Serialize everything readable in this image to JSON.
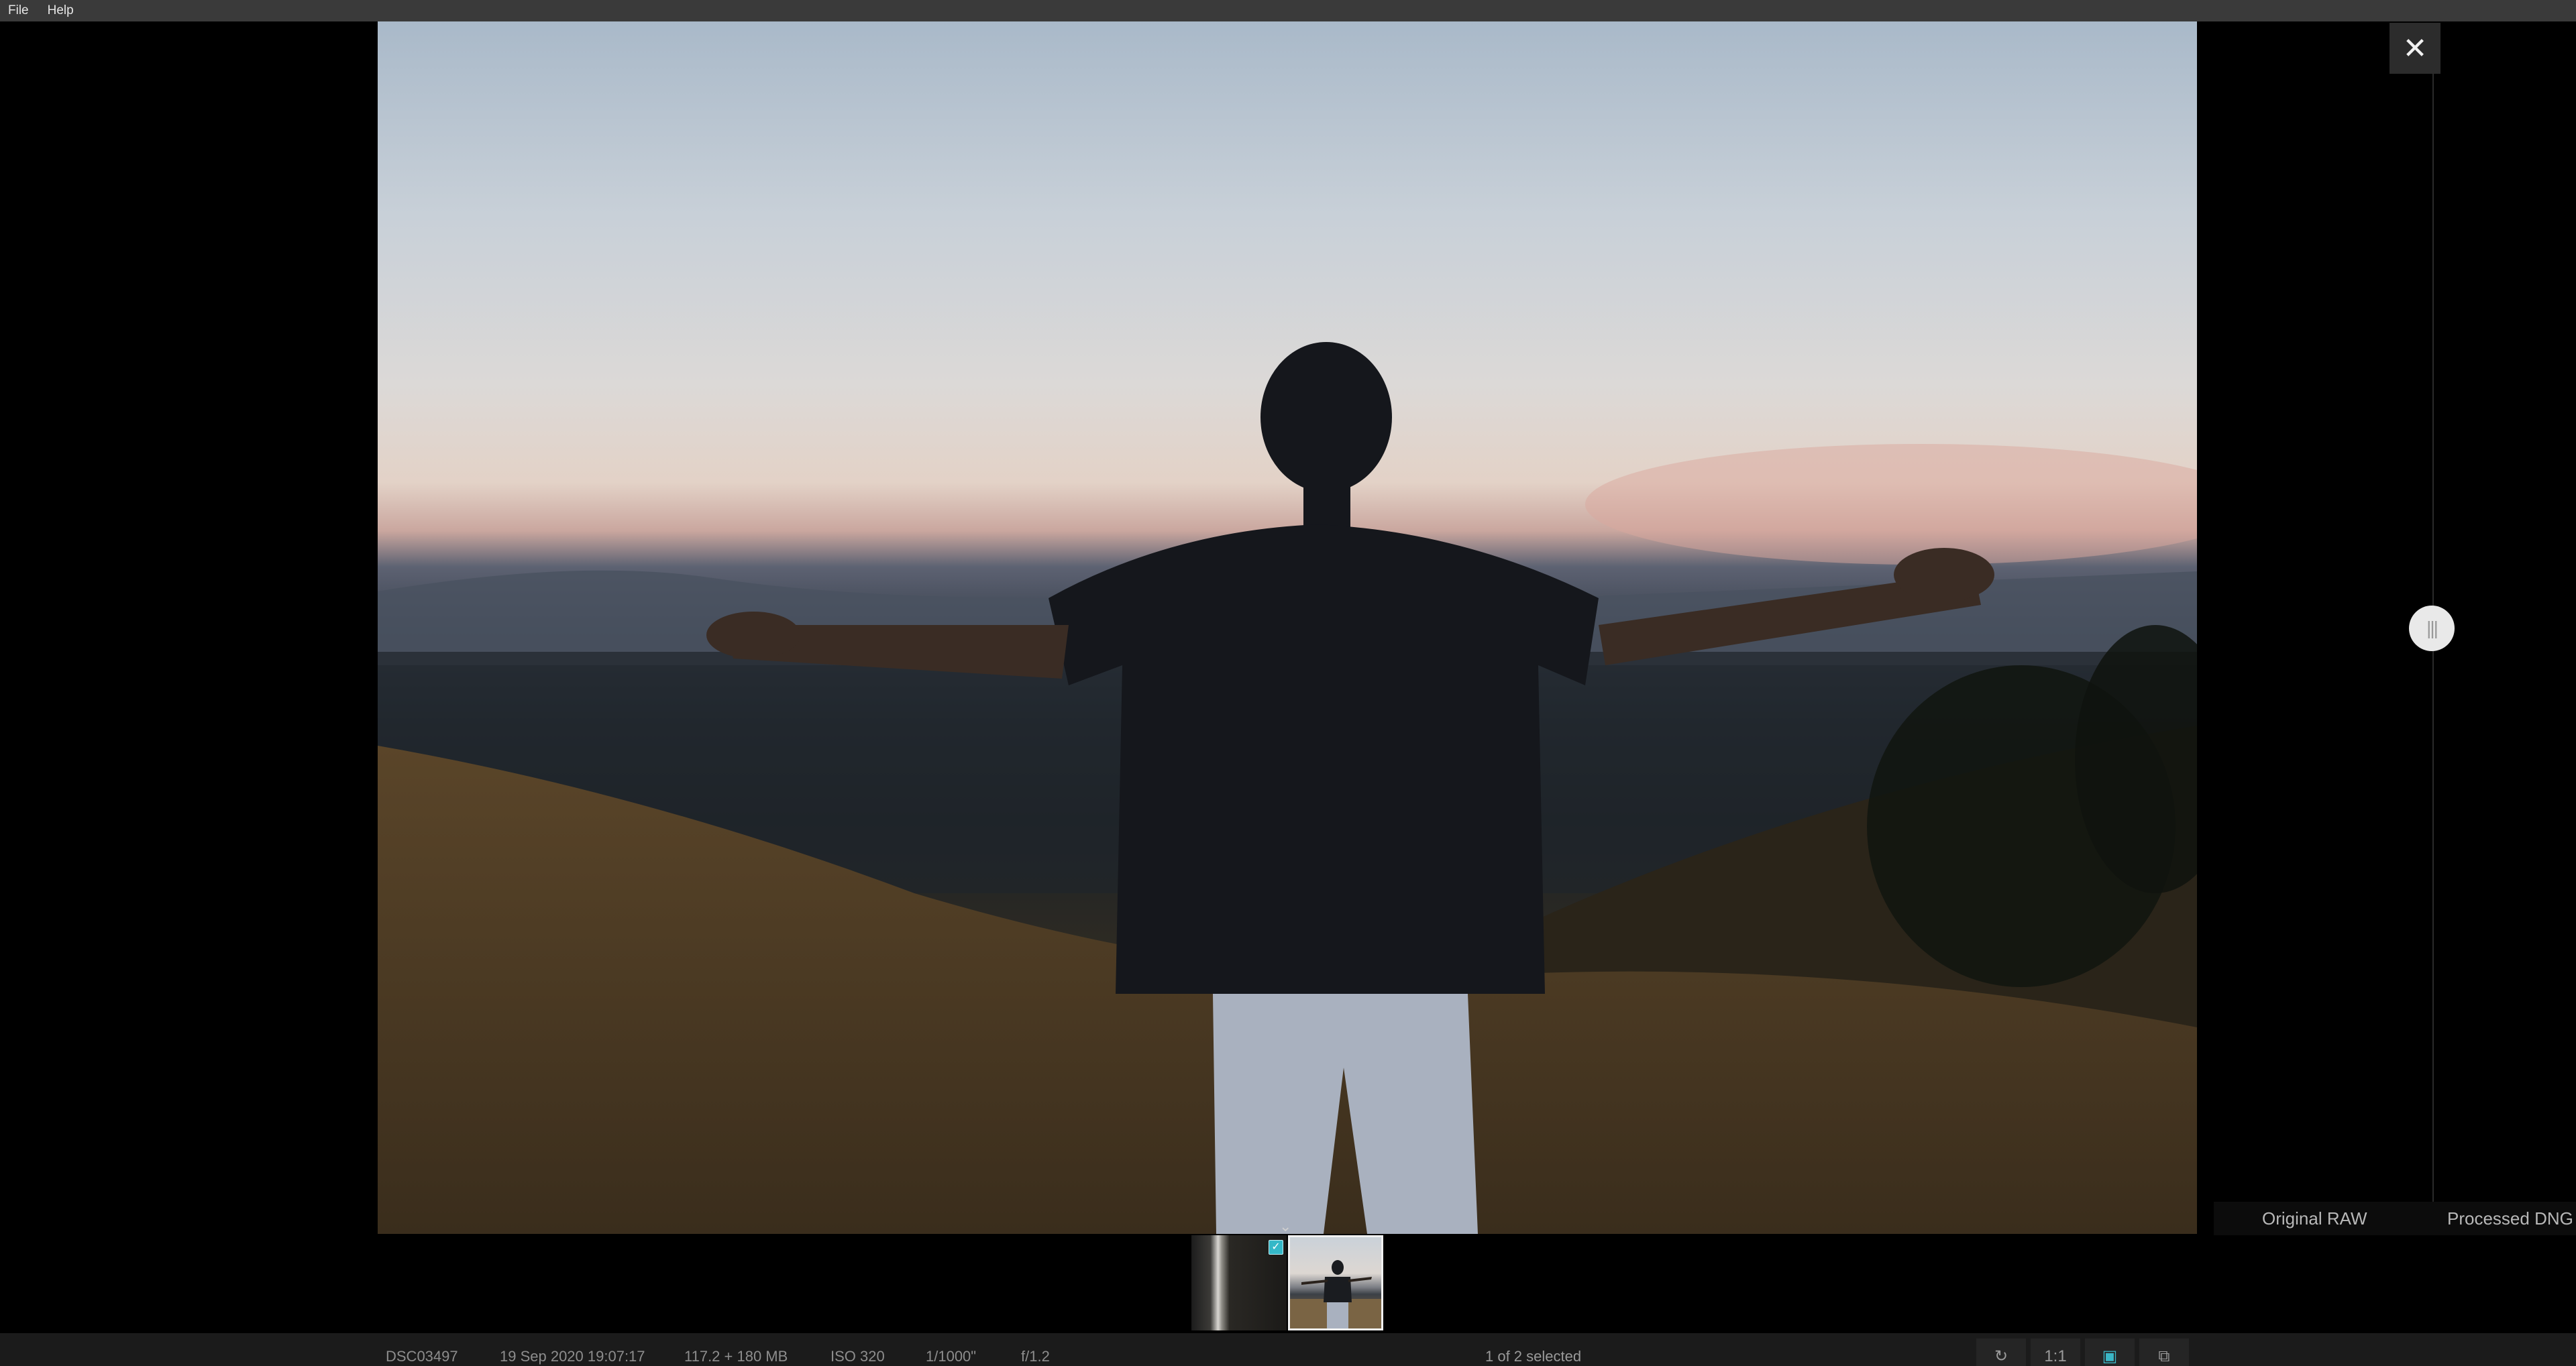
{
  "menu": {
    "items": [
      "File",
      "Help"
    ]
  },
  "viewer": {
    "close_icon": "close-icon",
    "slider_icon": "grip-icon"
  },
  "compare": {
    "left_label": "Original RAW",
    "right_label": "Processed DNG"
  },
  "filmstrip": {
    "collapse_icon": "chevron-down-icon",
    "checked_icon": "checkbox-checked-icon"
  },
  "status": {
    "filename": "DSC03497",
    "date": "19 Sep 2020 19:07:17",
    "size": "117.2 + 180 MB",
    "iso": "ISO 320",
    "shutter": "1/1000\"",
    "aperture": "f/1.2",
    "selection": "1 of 2 selected"
  },
  "toolbar": {
    "zoom_label": "1:1",
    "rotate_icon": "rotate-icon",
    "image_icon": "image-icon",
    "compare_icon": "stack-icon"
  },
  "colors": {
    "accent": "#3ab6c6"
  }
}
